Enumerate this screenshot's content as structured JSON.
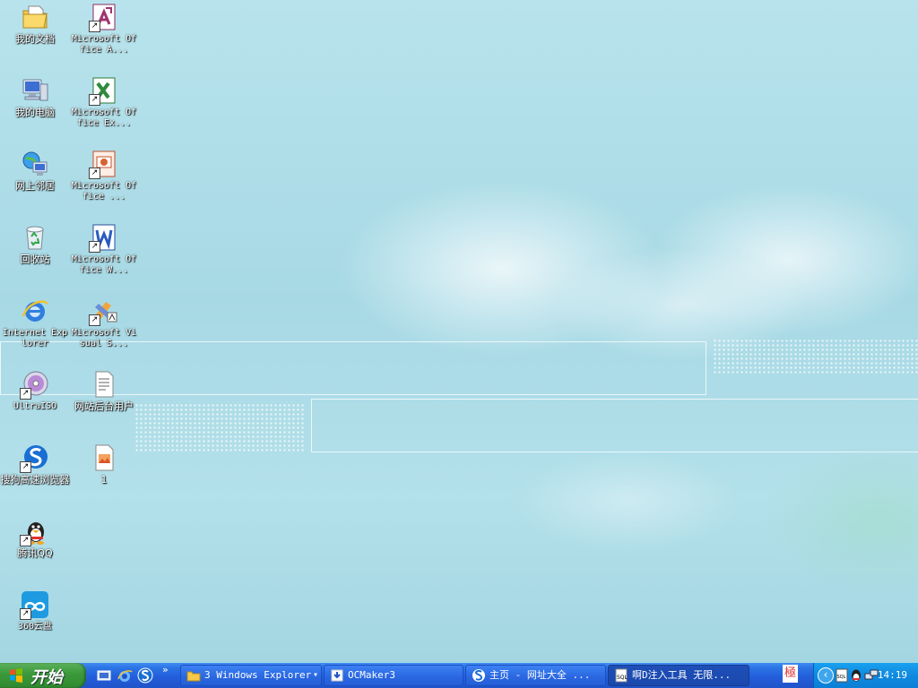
{
  "desktop_icons": [
    {
      "label": "我的文档",
      "icon": "my-documents-icon"
    },
    {
      "label": "我的电脑",
      "icon": "my-computer-icon"
    },
    {
      "label": "网上邻居",
      "icon": "network-places-icon"
    },
    {
      "label": "回收站",
      "icon": "recycle-bin-icon"
    },
    {
      "label": "Internet Explorer",
      "icon": "internet-explorer-icon"
    },
    {
      "label": "UltraISO",
      "icon": "ultraiso-icon"
    },
    {
      "label": "搜狗高速浏览器",
      "icon": "sogou-browser-icon"
    },
    {
      "label": "腾讯QQ",
      "icon": "qq-icon"
    },
    {
      "label": "360云盘",
      "icon": "360-cloud-icon"
    },
    {
      "label": "Microsoft Office A...",
      "icon": "office-access-icon"
    },
    {
      "label": "Microsoft Office Ex...",
      "icon": "office-excel-icon"
    },
    {
      "label": "Microsoft Office ...",
      "icon": "office-powerpoint-icon"
    },
    {
      "label": "Microsoft Office W...",
      "icon": "office-word-icon"
    },
    {
      "label": "Microsoft Visual S...",
      "icon": "visual-studio-icon"
    },
    {
      "label": "网站后台用户",
      "icon": "text-file-icon"
    },
    {
      "label": "1",
      "icon": "image-file-icon"
    }
  ],
  "taskbar": {
    "start_label": "开始",
    "quicklaunch_more": "»",
    "tasks": [
      {
        "label": "3 Windows Explorer",
        "dropdown": "▾"
      },
      {
        "label": "OCMaker3"
      },
      {
        "label": "主页 - 网址大全 ..."
      },
      {
        "label": "啊D注入工具 无限..."
      }
    ],
    "tray": {
      "ime_label": "極",
      "clock": "14:19",
      "collapse_arrow": "‹"
    }
  },
  "colors": {
    "taskbar_blue": "#245edb",
    "start_green": "#3c9a3c",
    "tray_blue": "#0f8ae0"
  }
}
